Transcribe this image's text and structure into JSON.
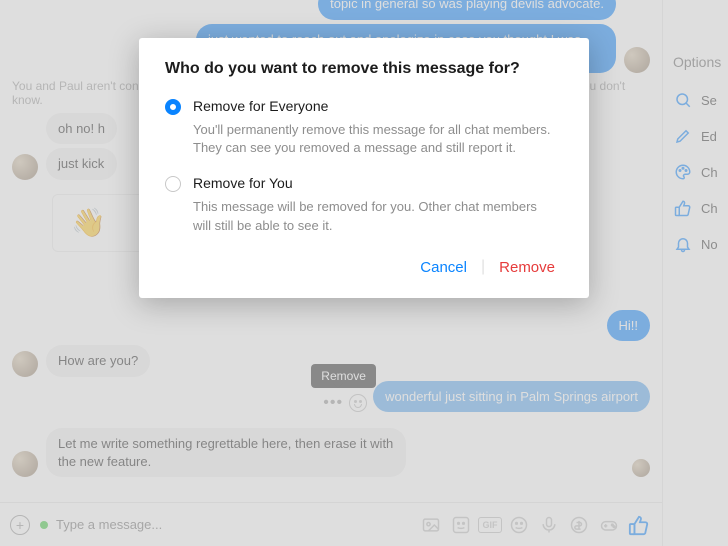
{
  "modal": {
    "title": "Who do you want to remove this message for?",
    "options": [
      {
        "label": "Remove for Everyone",
        "desc": "You'll permanently remove this message for all chat members. They can see you removed a message and still report it."
      },
      {
        "label": "Remove for You",
        "desc": "This message will be removed for you. Other chat members will still be able to see it."
      }
    ],
    "cancel": "Cancel",
    "remove": "Remove"
  },
  "messages": {
    "out_top_1": "topic in general so was playing devils advocate.",
    "out_top_2": "just wanted to reach out and apologize in case you thought I was being a jerk.",
    "notice": "You and Paul aren't connected on Facebook. Be careful sharing personal info or clicking links from people you don't know.",
    "in_1": "oh no! h",
    "in_2": "just kick",
    "out_hi": "Hi!!",
    "in_how": "How are you?",
    "out_palm": "wonderful just sitting in Palm Springs airport",
    "in_regret": "Let me write something regrettable here, then erase it with the new feature."
  },
  "tooltip": {
    "remove": "Remove"
  },
  "composer": {
    "placeholder": "Type a message..."
  },
  "options_panel": {
    "title": "Options",
    "items": [
      {
        "label": "Se"
      },
      {
        "label": "Ed"
      },
      {
        "label": "Ch"
      },
      {
        "label": "Ch"
      },
      {
        "label": "No"
      }
    ]
  },
  "glyphs": {
    "wave": "👋",
    "gif": "GIF"
  }
}
